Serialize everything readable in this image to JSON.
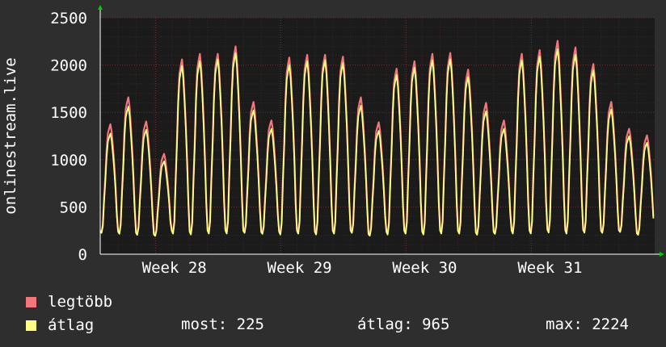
{
  "chart_data": {
    "type": "line",
    "ylabel": "onlinestream.live",
    "ylim": [
      0,
      2500
    ],
    "yticks": [
      "0",
      "500",
      "1000",
      "1500",
      "2000",
      "2500"
    ],
    "xticks": [
      "Week 28",
      "Week 29",
      "Week 30",
      "Week 31"
    ],
    "grid": true,
    "legend_position": "bottom",
    "colors": {
      "max_series": "#f2777a",
      "avg_series": "#ffff88",
      "background": "#2e2e2e",
      "plot_bg": "#1b1b1b",
      "grid": "#5a2a2a",
      "arrow": "#00cc00"
    },
    "days": 31,
    "series": [
      {
        "name": "legtöbb",
        "color": "#f2777a",
        "daily_peak": [
          1400,
          1690,
          1430,
          1080,
          2100,
          2160,
          2160,
          2240,
          1640,
          1440,
          2120,
          2150,
          2150,
          2130,
          1690,
          1420,
          2000,
          2080,
          2160,
          2170,
          1990,
          1630,
          1440,
          2160,
          2200,
          2300,
          2230,
          2050,
          1640,
          1350,
          1280
        ],
        "daily_min": [
          230,
          220,
          210,
          200,
          220,
          210,
          220,
          220,
          230,
          220,
          210,
          220,
          210,
          220,
          230,
          200,
          210,
          220,
          210,
          220,
          220,
          210,
          220,
          220,
          220,
          230,
          220,
          230,
          230,
          240,
          210
        ]
      },
      {
        "name": "átlag",
        "color": "#ffff88",
        "daily_peak": [
          1300,
          1590,
          1340,
          1000,
          2030,
          2080,
          2100,
          2170,
          1550,
          1350,
          2040,
          2080,
          2090,
          2060,
          1600,
          1330,
          1930,
          2010,
          2090,
          2100,
          1910,
          1540,
          1350,
          2090,
          2130,
          2210,
          2150,
          1980,
          1560,
          1270,
          1200
        ],
        "daily_min": [
          220,
          210,
          200,
          190,
          210,
          200,
          210,
          210,
          220,
          210,
          200,
          210,
          200,
          210,
          220,
          190,
          200,
          210,
          200,
          210,
          210,
          200,
          210,
          210,
          210,
          220,
          210,
          220,
          220,
          230,
          200
        ]
      }
    ]
  },
  "legend": [
    {
      "label": "legtöbb",
      "color": "#f2777a"
    },
    {
      "label": "átlag",
      "color": "#ffff88"
    }
  ],
  "stats": {
    "now": "most: 225",
    "avg": "átlag: 965",
    "max": "max: 2224"
  }
}
